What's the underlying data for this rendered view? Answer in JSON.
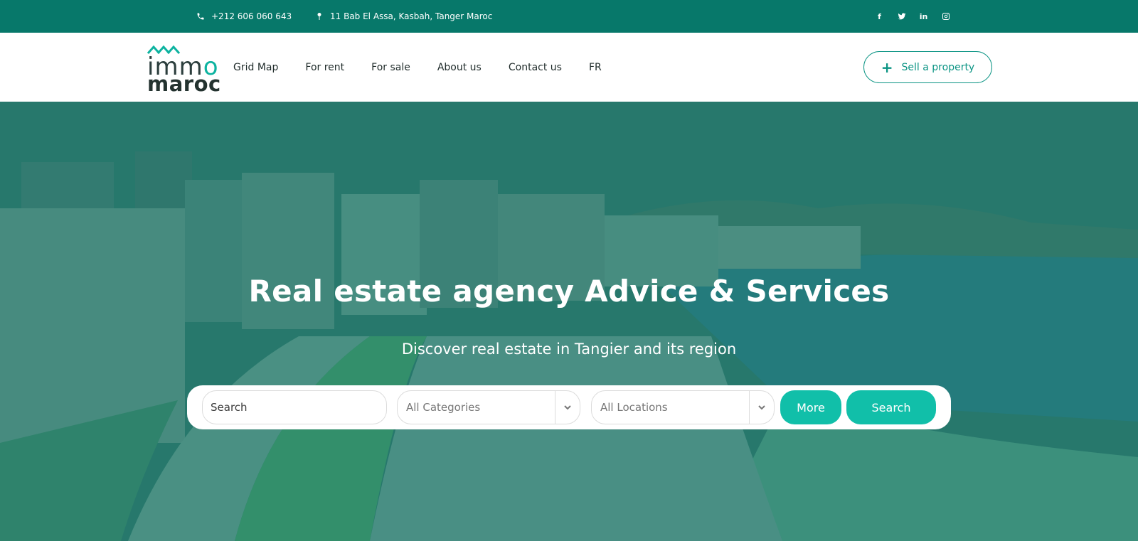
{
  "topbar": {
    "phone": "+212 606 060 643",
    "address": "11 Bab El Assa, Kasbah, Tanger Maroc",
    "socials": [
      "facebook-icon",
      "twitter-icon",
      "linkedin-icon",
      "instagram-icon"
    ],
    "bg_color": "#07786a"
  },
  "logo": {
    "line1_a": "imm",
    "line1_b": "o",
    "line2": "maroc"
  },
  "nav": {
    "items": [
      "Grid Map",
      "For rent",
      "For sale",
      "About us",
      "Contact us",
      "FR"
    ]
  },
  "sell_button": {
    "label": "Sell a property",
    "icon": "plus-icon"
  },
  "hero": {
    "title": "Real estate agency Advice & Services",
    "subtitle": "Discover real estate in Tangier and its region"
  },
  "search": {
    "search_placeholder": "Search",
    "categories_value": "All Categories",
    "locations_value": "All Locations",
    "more_label": "More",
    "search_label": "Search",
    "accent_color": "#11bfa9"
  }
}
